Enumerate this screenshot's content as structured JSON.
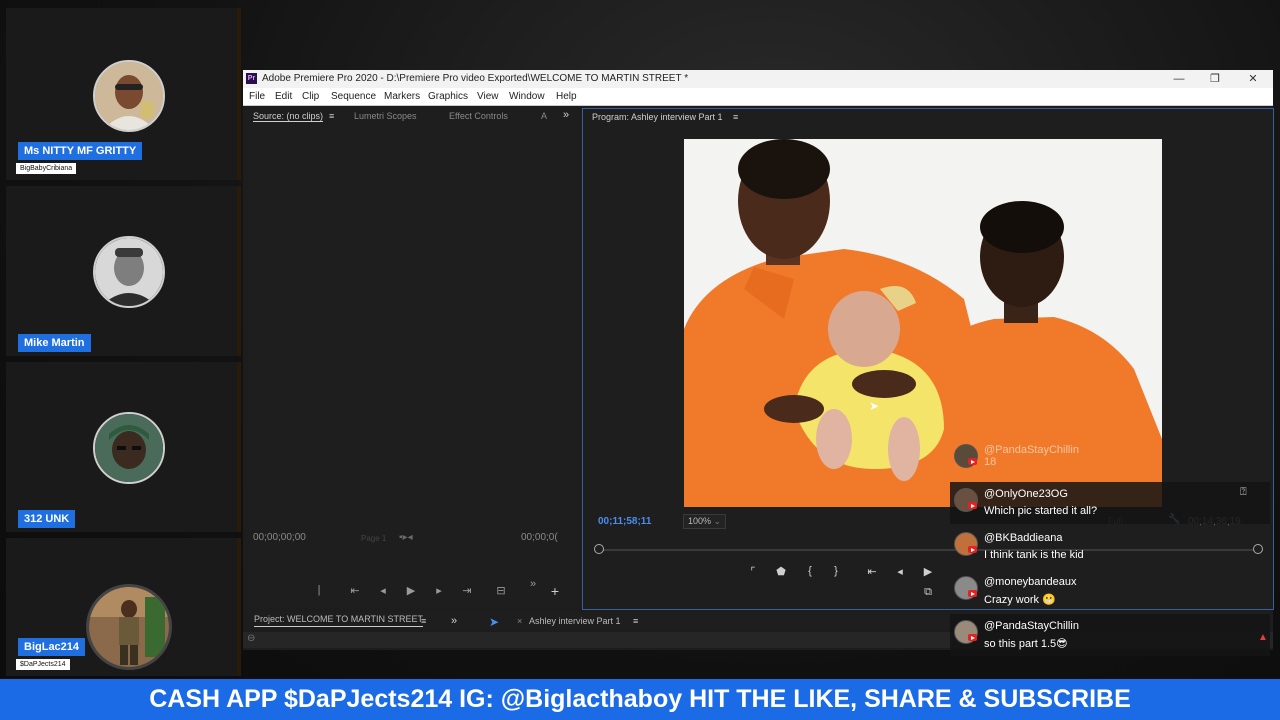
{
  "participants": [
    {
      "name": "Ms NITTY MF GRITTY",
      "subtitle": "BigBabyCribiana"
    },
    {
      "name": "Mike Martin",
      "subtitle": ""
    },
    {
      "name": "312 UNK",
      "subtitle": ""
    },
    {
      "name": "BigLac214",
      "subtitle": "$DaPJects214"
    }
  ],
  "window": {
    "title": "Adobe Premiere Pro 2020 - D:\\Premiere Pro video Exported\\WELCOME TO MARTIN STREET *",
    "app_icon": "Pr",
    "minimize": "—",
    "maximize": "❐",
    "close": "✕"
  },
  "menu": [
    "File",
    "Edit",
    "Clip",
    "Sequence",
    "Markers",
    "Graphics",
    "View",
    "Window",
    "Help"
  ],
  "source_panel": {
    "tabs": [
      "Source: (no clips)",
      "Lumetri Scopes",
      "Effect Controls",
      "A"
    ],
    "timecode_in": "00;00;00;00",
    "page_label": "Page 1",
    "timecode_out": "00;00;0("
  },
  "program_panel": {
    "title": "Program: Ashley interview Part 1",
    "timecode": "00;11;58;11",
    "zoom": "100%",
    "quality": "Full",
    "duration": "00;14;36;19"
  },
  "project_bar": {
    "project": "Project: WELCOME TO MARTIN STREET",
    "sequence": "Ashley interview Part 1"
  },
  "chat": [
    {
      "user": "@PandaStayChillin",
      "message": "18"
    },
    {
      "user": "@OnlyOne23OG",
      "message": "Which pic started it all?"
    },
    {
      "user": "@BKBaddieana",
      "message": "I think tank is the kid"
    },
    {
      "user": "@moneybandeaux",
      "message": "Crazy work 😬"
    },
    {
      "user": "@PandaStayChillin",
      "message": "so this part 1.5😎"
    }
  ],
  "banner": "CASH APP $DaPJects214 IG: @Biglacthaboy HIT THE LIKE, SHARE & SUBSCRIBE",
  "colors": {
    "accent": "#1f6fe0",
    "banner": "#1b6ae6",
    "timecode": "#4a8ef0",
    "shirt": "#f07a2a"
  }
}
